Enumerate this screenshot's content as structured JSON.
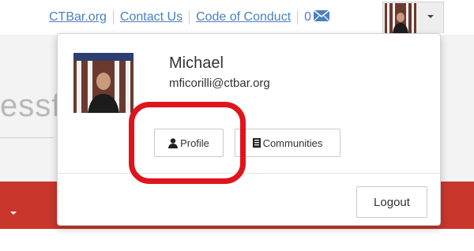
{
  "topnav": {
    "links": [
      "CTBar.org",
      "Contact Us",
      "Code of Conduct"
    ],
    "message_count": "0",
    "mail_icon": "envelope-icon",
    "caret_icon": "chevron-down-icon"
  },
  "background": {
    "title_fragment": "essf"
  },
  "profile_menu": {
    "name": "Michael",
    "email": "mficorilli@ctbar.org",
    "profile_button": "Profile",
    "profile_icon": "user-icon",
    "communities_button": "Communities",
    "communities_icon": "list-icon",
    "logout_button": "Logout"
  },
  "colors": {
    "link": "#4a7fc0",
    "header_red": "#c8362c",
    "highlight_red": "#e0141b"
  }
}
